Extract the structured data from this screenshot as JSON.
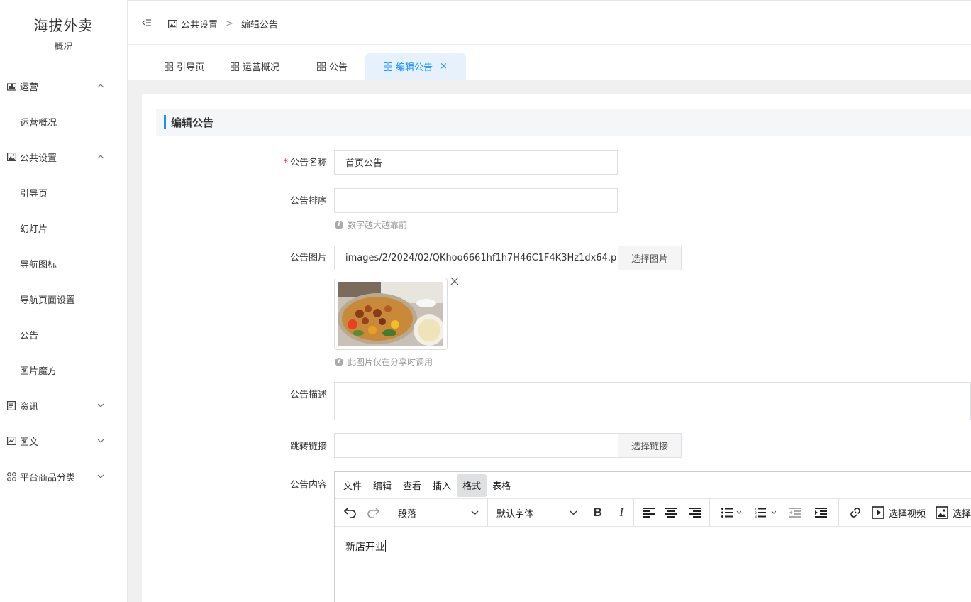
{
  "brand": {
    "title": "海拔外卖",
    "subtitle": "概况"
  },
  "sidebar": {
    "groups": [
      {
        "label": "运营",
        "icon": "dashboard-icon",
        "state": "expanded",
        "items": [
          "运营概况"
        ]
      },
      {
        "label": "公共设置",
        "icon": "image-icon",
        "state": "expanded",
        "items": [
          "引导页",
          "幻灯片",
          "导航图标",
          "导航页面设置",
          "公告",
          "图片魔方"
        ]
      },
      {
        "label": "资讯",
        "icon": "news-icon",
        "state": "collapsed",
        "items": []
      },
      {
        "label": "图文",
        "icon": "picture-text-icon",
        "state": "collapsed",
        "items": []
      },
      {
        "label": "平台商品分类",
        "icon": "category-icon",
        "state": "collapsed",
        "items": []
      }
    ]
  },
  "header": {
    "breadcrumb": [
      "公共设置",
      "编辑公告"
    ],
    "breadcrumb_sep": ">"
  },
  "tabs": [
    {
      "label": "引导页",
      "active": false
    },
    {
      "label": "运营概况",
      "active": false
    },
    {
      "label": "公告",
      "active": false
    },
    {
      "label": "编辑公告",
      "active": true,
      "close": "×"
    }
  ],
  "section": {
    "title": "编辑公告"
  },
  "form": {
    "name": {
      "label": "公告名称",
      "required_mark": "*",
      "value": "首页公告"
    },
    "sort": {
      "label": "公告排序",
      "value": "",
      "hint": "数字越大越靠前"
    },
    "image": {
      "label": "公告图片",
      "value": "images/2/2024/02/QKhoo6661hf1h7H46C1F4K3Hz1dx64.p",
      "button": "选择图片",
      "hint": "此图片仅在分享时调用"
    },
    "desc": {
      "label": "公告描述",
      "value": ""
    },
    "link": {
      "label": "跳转链接",
      "value": "",
      "button": "选择链接"
    },
    "content": {
      "label": "公告内容"
    }
  },
  "editor": {
    "menus": [
      "文件",
      "编辑",
      "查看",
      "插入",
      "格式",
      "表格"
    ],
    "active_menu": "格式",
    "block_format": "段落",
    "font_family": "默认字体",
    "video_button": "选择视频",
    "image_button": "选择",
    "body": "新店开业"
  },
  "colors": {
    "accent": "#1890ff",
    "required": "#f5222d"
  }
}
